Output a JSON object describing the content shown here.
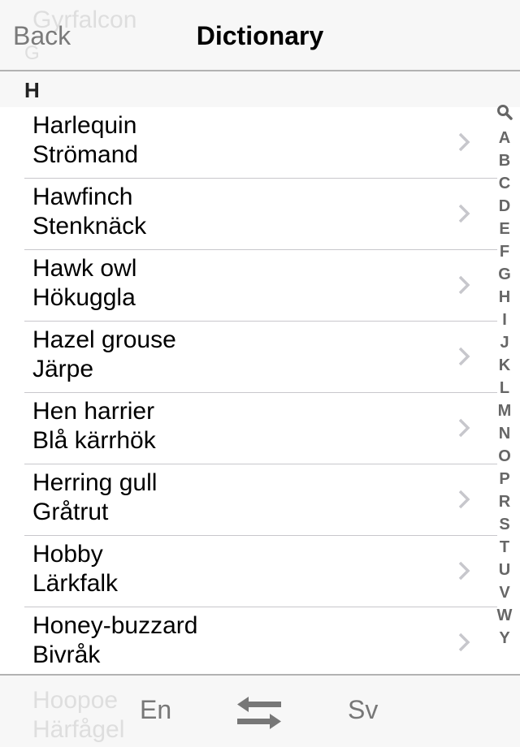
{
  "navbar": {
    "back_label": "Back",
    "title": "Dictionary",
    "ghost_word": "Gyrfalcon",
    "ghost_section": "G"
  },
  "section": {
    "letter": "H"
  },
  "entries": [
    {
      "en": "Harlequin",
      "sv": "Strömand"
    },
    {
      "en": "Hawfinch",
      "sv": "Stenknäck"
    },
    {
      "en": "Hawk owl",
      "sv": "Hökuggla"
    },
    {
      "en": "Hazel grouse",
      "sv": "Järpe"
    },
    {
      "en": "Hen harrier",
      "sv": "Blå kärrhök"
    },
    {
      "en": "Herring gull",
      "sv": "Gråtrut"
    },
    {
      "en": "Hobby",
      "sv": "Lärkfalk"
    },
    {
      "en": "Honey-buzzard",
      "sv": "Bivråk"
    }
  ],
  "index": {
    "search_icon": "search-icon",
    "letters": [
      "A",
      "B",
      "C",
      "D",
      "E",
      "F",
      "G",
      "H",
      "I",
      "J",
      "K",
      "L",
      "M",
      "N",
      "O",
      "P",
      "R",
      "S",
      "T",
      "U",
      "V",
      "W",
      "Y"
    ]
  },
  "toolbar": {
    "source_lang": "En",
    "target_lang": "Sv",
    "swap_icon": "swap-arrows-icon",
    "ghost_en": "Hoopoe",
    "ghost_sv": "Härfågel"
  },
  "colors": {
    "bar_bg": "#f7f7f7",
    "separator": "#c8c7cc",
    "secondary_text": "#777777"
  }
}
